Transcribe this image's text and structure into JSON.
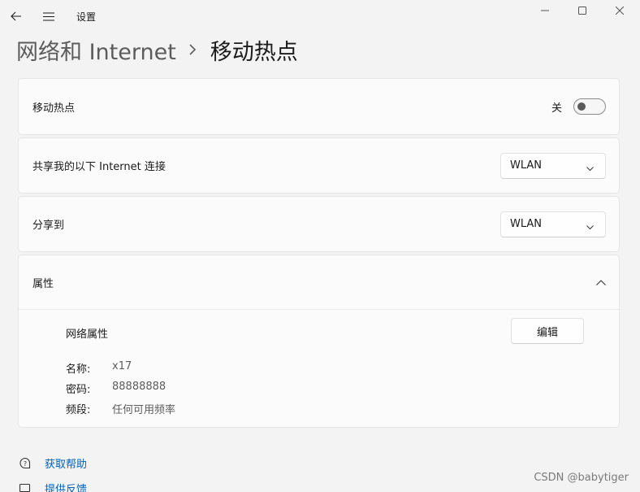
{
  "app": {
    "title": "设置"
  },
  "breadcrumb": {
    "parent": "网络和 Internet",
    "current": "移动热点"
  },
  "hotspot": {
    "label": "移动热点",
    "state_label": "关",
    "enabled": false
  },
  "share_connection": {
    "label": "共享我的以下 Internet 连接",
    "selected": "WLAN"
  },
  "share_over": {
    "label": "分享到",
    "selected": "WLAN"
  },
  "properties": {
    "header": "属性",
    "expanded": true,
    "section_title": "网络属性",
    "edit_label": "编辑",
    "fields": [
      {
        "key": "名称:",
        "value": "x17"
      },
      {
        "key": "密码:",
        "value": "88888888"
      },
      {
        "key": "频段:",
        "value": "任何可用频率"
      }
    ]
  },
  "footer": {
    "help": "获取帮助",
    "feedback": "提供反馈"
  },
  "watermark": "CSDN @babytiger",
  "icons": {
    "back": "back-arrow-icon",
    "menu": "hamburger-menu-icon",
    "minimize": "minimize-icon",
    "maximize": "maximize-icon",
    "close": "close-icon",
    "help": "help-chat-icon",
    "feedback": "feedback-icon"
  },
  "colors": {
    "link": "#0060b8",
    "background": "#f3f3f3",
    "card": "#fbfbfb"
  }
}
